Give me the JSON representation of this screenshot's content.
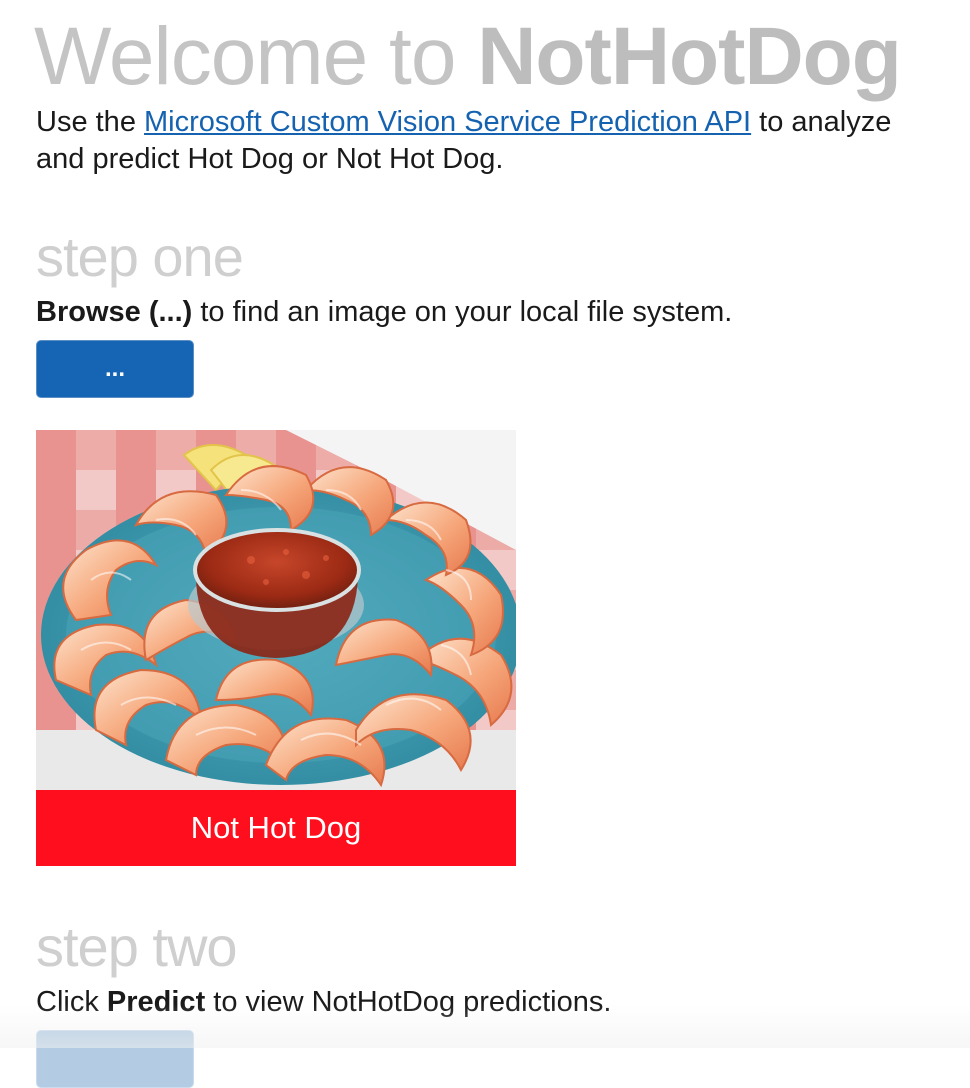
{
  "header": {
    "title_prefix": "Welcome to",
    "title_brand": "NotHotDog"
  },
  "intro": {
    "text_before_link": "Use the",
    "link_text": "Microsoft Custom Vision Service Prediction API",
    "text_after_link": "to analyze and predict Hot Dog or Not Hot Dog."
  },
  "step_one": {
    "heading": "step one",
    "instruction_bold": "Browse (...)",
    "instruction_rest": "to find an image on your local file system.",
    "browse_button_label": "..."
  },
  "preview": {
    "result_label": "Not Hot Dog",
    "result_color": "#ff0f1e"
  },
  "step_two": {
    "heading": "step two",
    "instruction_prefix": "Click",
    "instruction_bold": "Predict",
    "instruction_rest": "to view NotHotDog predictions."
  },
  "colors": {
    "accent": "#1565b4",
    "link": "#1563b0",
    "title_gray": "#bdbdbd",
    "disabled_button": "#b3cce3"
  }
}
